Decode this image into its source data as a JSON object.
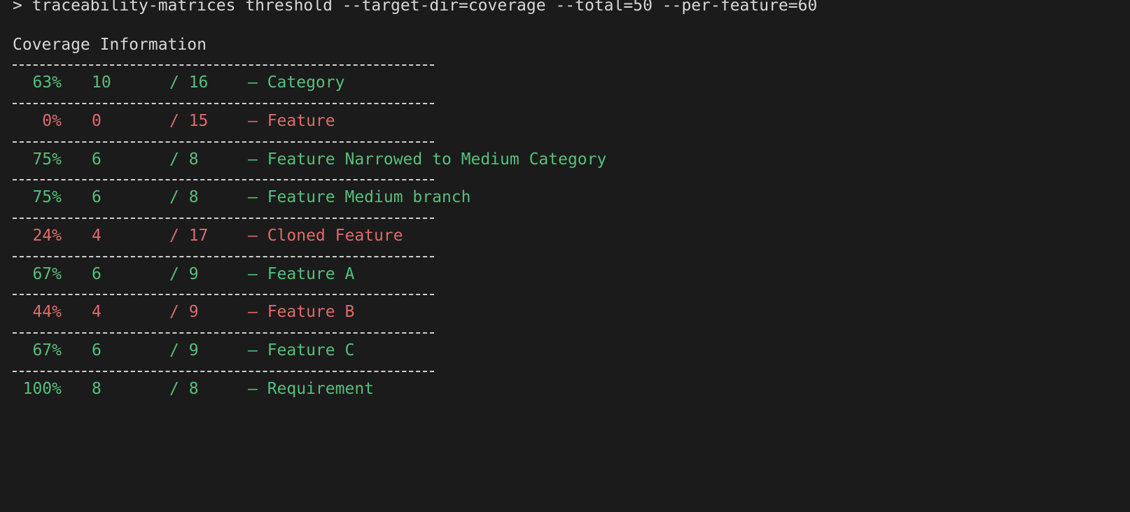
{
  "terminal": {
    "command": "> traceability-matrices threshold --target-dir=coverage --total=50 --per-feature=60",
    "heading": "Coverage Information",
    "colors": {
      "background": "#1b1b1b",
      "pass": "#55c07a",
      "fail": "#de6b6b",
      "text": "#d7d7d7"
    },
    "rows": [
      {
        "percent": "63%",
        "covered": "10",
        "total": "/ 16",
        "name": "– Category",
        "status": "ok"
      },
      {
        "percent": "0%",
        "covered": "0",
        "total": "/ 15",
        "name": "– Feature",
        "status": "fail"
      },
      {
        "percent": "75%",
        "covered": "6",
        "total": "/ 8",
        "name": "– Feature Narrowed to Medium Category",
        "status": "ok"
      },
      {
        "percent": "75%",
        "covered": "6",
        "total": "/ 8",
        "name": "– Feature Medium branch",
        "status": "ok"
      },
      {
        "percent": "24%",
        "covered": "4",
        "total": "/ 17",
        "name": "– Cloned Feature",
        "status": "fail"
      },
      {
        "percent": "67%",
        "covered": "6",
        "total": "/ 9",
        "name": "– Feature A",
        "status": "ok"
      },
      {
        "percent": "44%",
        "covered": "4",
        "total": "/ 9",
        "name": "– Feature B",
        "status": "fail"
      },
      {
        "percent": "67%",
        "covered": "6",
        "total": "/ 9",
        "name": "– Feature C",
        "status": "ok"
      },
      {
        "percent": "100%",
        "covered": "8",
        "total": "/ 8",
        "name": "– Requirement",
        "status": "ok"
      }
    ]
  }
}
